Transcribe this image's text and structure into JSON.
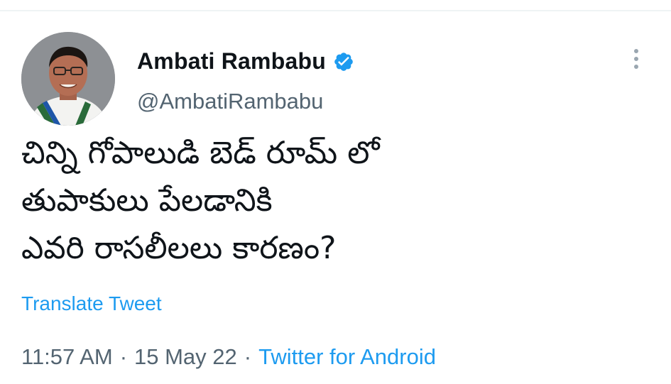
{
  "tweet": {
    "author": {
      "display_name": "Ambati Rambabu",
      "handle": "@AmbatiRambabu",
      "verified": true,
      "avatar_icon": "profile-photo"
    },
    "text_lines": [
      "చిన్ని గోపాలుడి బెడ్ రూమ్ లో",
      "తుపాకులు పేలడానికి",
      "ఎవరి రాసలీలలు కారణం?"
    ],
    "translate_label": "Translate Tweet",
    "meta": {
      "time": "11:57 AM",
      "separator": "·",
      "date": "15 May 22",
      "source": "Twitter for Android"
    },
    "more_icon": "more-vertical-icon"
  },
  "colors": {
    "accent": "#1d9bf0",
    "text": "#0f1419",
    "secondary": "#536471",
    "divider": "#eff3f4"
  }
}
